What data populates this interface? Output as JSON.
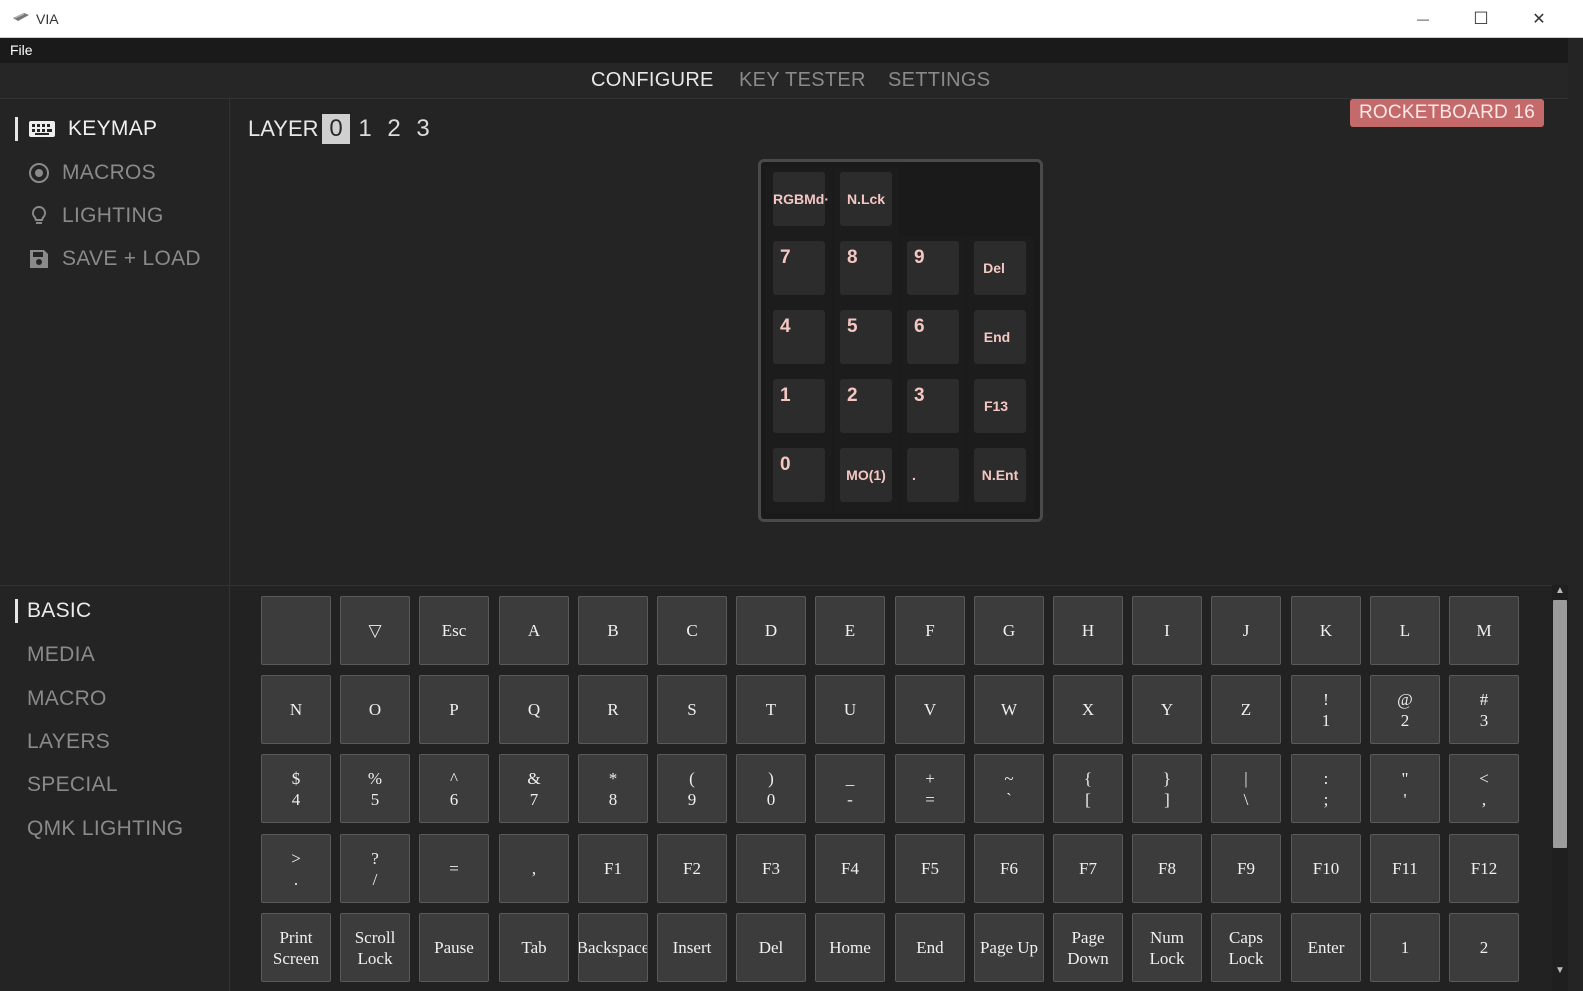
{
  "window": {
    "title": "VIA",
    "minimize_glyph": "—",
    "maximize_glyph": "☐",
    "close_glyph": "✕"
  },
  "menubar": {
    "file": "File"
  },
  "nav": {
    "tabs": [
      "CONFIGURE",
      "KEY TESTER",
      "SETTINGS"
    ],
    "active": "CONFIGURE"
  },
  "sidebar": {
    "items": [
      {
        "label": "KEYMAP",
        "icon": "keyboard-icon"
      },
      {
        "label": "MACROS",
        "icon": "record-icon"
      },
      {
        "label": "LIGHTING",
        "icon": "lightbulb-icon"
      },
      {
        "label": "SAVE + LOAD",
        "icon": "floppy-disk-icon"
      }
    ]
  },
  "layer": {
    "label": "LAYER",
    "numbers": [
      "0",
      "1",
      "2",
      "3"
    ],
    "active": "0"
  },
  "device": {
    "name": "ROCKETBOARD 16"
  },
  "keyboard": {
    "keys": [
      "RGBMd·",
      "N.Lck",
      "7",
      "8",
      "9",
      "Del",
      "4",
      "5",
      "6",
      "End",
      "1",
      "2",
      "3",
      "F13",
      "0",
      "MO(1)",
      ".",
      "N.Ent"
    ]
  },
  "categories": [
    "BASIC",
    "MEDIA",
    "MACRO",
    "LAYERS",
    "SPECIAL",
    "QMK LIGHTING"
  ],
  "palette": {
    "rows": [
      [
        "",
        "▽",
        "Esc",
        "A",
        "B",
        "C",
        "D",
        "E",
        "F",
        "G",
        "H",
        "I",
        "J",
        "K",
        "L",
        "M"
      ],
      [
        "N",
        "O",
        "P",
        "Q",
        "R",
        "S",
        "T",
        "U",
        "V",
        "W",
        "X",
        "Y",
        "Z",
        "!\n1",
        "@\n2",
        "#\n3"
      ],
      [
        "$\n4",
        "%\n5",
        "^\n6",
        "&\n7",
        "*\n8",
        "(\n9",
        ")\n0",
        "_\n-",
        "+\n=",
        "~\n`",
        "{\n[",
        "}\n]",
        "|\n\\",
        ":\n;",
        "\"\n'",
        "<\n,"
      ],
      [
        ">\n.",
        "?\n/",
        "=",
        ",",
        "F1",
        "F2",
        "F3",
        "F4",
        "F5",
        "F6",
        "F7",
        "F8",
        "F9",
        "F10",
        "F11",
        "F12"
      ],
      [
        "Print\nScreen",
        "Scroll\nLock",
        "Pause",
        "Tab",
        "Backspace",
        "Insert",
        "Del",
        "Home",
        "End",
        "Page Up",
        "Page\nDown",
        "Num\nLock",
        "Caps\nLock",
        "Enter",
        "1",
        "2"
      ]
    ]
  },
  "colors": {
    "accent_badge": "#c46a6a",
    "keycap_legend": "#f4c7c2",
    "background": "#242424"
  }
}
